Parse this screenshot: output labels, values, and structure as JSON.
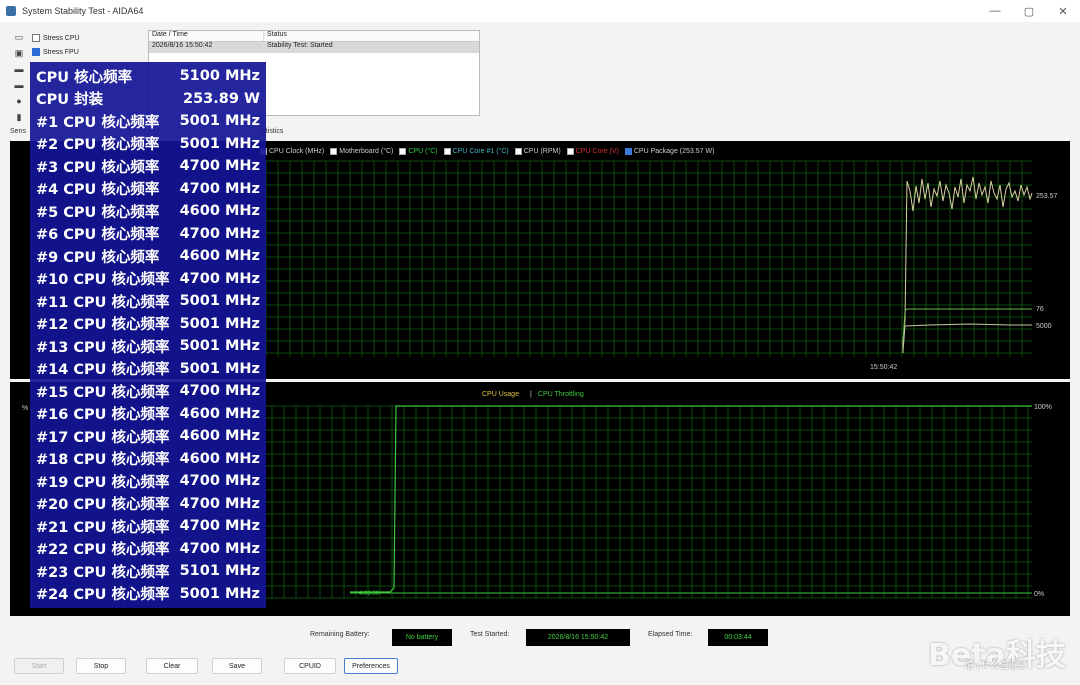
{
  "window": {
    "title": "System Stability Test - AIDA64",
    "controls": [
      "—",
      "▢",
      "✕"
    ]
  },
  "stress_options": [
    {
      "label": "Stress CPU",
      "checked": false
    },
    {
      "label": "Stress FPU",
      "checked": true
    }
  ],
  "log": {
    "headers": [
      "Date / Time",
      "Status"
    ],
    "rows": [
      {
        "time": "2026/8/16 15:50:42",
        "status": "Stability Test: Started"
      }
    ]
  },
  "tabs": {
    "left": "Sens",
    "right": "atistics"
  },
  "graph1": {
    "legend": [
      {
        "label": "CPU Clock (MHz)",
        "checked": false,
        "color": "#cccccc"
      },
      {
        "label": "Motherboard (°C)",
        "checked": false,
        "color": "#cccccc"
      },
      {
        "label": "CPU (°C)",
        "checked": false,
        "color": "#2ecc40"
      },
      {
        "label": "CPU Core #1 (°C)",
        "checked": false,
        "color": "#3fb8c8"
      },
      {
        "label": "CPU (RPM)",
        "checked": false,
        "color": "#cccccc"
      },
      {
        "label": "CPU Core (V)",
        "checked": false,
        "color": "#d83030"
      },
      {
        "label": "CPU Package (253.57 W)",
        "checked": true,
        "color": "#cccccc"
      }
    ],
    "right_labels": {
      "top": "253.57",
      "mid1": "76",
      "mid2": "5000"
    },
    "time_label": "15:50:42"
  },
  "graph2": {
    "title_a": "CPU Usage",
    "separator": "|",
    "title_b": "CPU Throttling",
    "left_top": "%",
    "right_top": "100%",
    "right_bottom": "0%",
    "bottom_label": "4:08:00"
  },
  "overlay": [
    {
      "name": "CPU 核心频率",
      "value": "5100 MHz"
    },
    {
      "name": "CPU 封装",
      "value": "253.89 W"
    },
    {
      "name": "#1 CPU 核心频率",
      "value": "5001 MHz"
    },
    {
      "name": "#2 CPU 核心频率",
      "value": "5001 MHz"
    },
    {
      "name": "#3 CPU 核心频率",
      "value": "4700 MHz"
    },
    {
      "name": "#4 CPU 核心频率",
      "value": "4700 MHz"
    },
    {
      "name": "#5 CPU 核心频率",
      "value": "4600 MHz"
    },
    {
      "name": "#6 CPU 核心频率",
      "value": "4700 MHz"
    },
    {
      "name": "#9 CPU 核心频率",
      "value": "4600 MHz"
    },
    {
      "name": "#10 CPU 核心频率",
      "value": "4700 MHz"
    },
    {
      "name": "#11 CPU 核心频率",
      "value": "5001 MHz"
    },
    {
      "name": "#12 CPU 核心频率",
      "value": "5001 MHz"
    },
    {
      "name": "#13 CPU 核心频率",
      "value": "5001 MHz"
    },
    {
      "name": "#14 CPU 核心频率",
      "value": "5001 MHz"
    },
    {
      "name": "#15 CPU 核心频率",
      "value": "4700 MHz"
    },
    {
      "name": "#16 CPU 核心频率",
      "value": "4600 MHz"
    },
    {
      "name": "#17 CPU 核心频率",
      "value": "4600 MHz"
    },
    {
      "name": "#18 CPU 核心频率",
      "value": "4600 MHz"
    },
    {
      "name": "#19 CPU 核心频率",
      "value": "4700 MHz"
    },
    {
      "name": "#20 CPU 核心频率",
      "value": "4700 MHz"
    },
    {
      "name": "#21 CPU 核心频率",
      "value": "4700 MHz"
    },
    {
      "name": "#22 CPU 核心频率",
      "value": "4700 MHz"
    },
    {
      "name": "#23 CPU 核心频率",
      "value": "5101 MHz"
    },
    {
      "name": "#24 CPU 核心频率",
      "value": "5001 MHz"
    }
  ],
  "status_bar": {
    "battery_label": "Remaining Battery:",
    "battery_value": "No battery",
    "started_label": "Test Started:",
    "started_value": "2026/8/16 15:50:42",
    "elapsed_label": "Elapsed Time:",
    "elapsed_value": "00:03:44"
  },
  "buttons": {
    "start": "Start",
    "stop": "Stop",
    "clear": "Clear",
    "save": "Save",
    "cpuid": "CPUID",
    "preferences": "Preferences"
  },
  "watermark": {
    "main": "Beta科技",
    "sub": "值 | 什么值得买"
  }
}
